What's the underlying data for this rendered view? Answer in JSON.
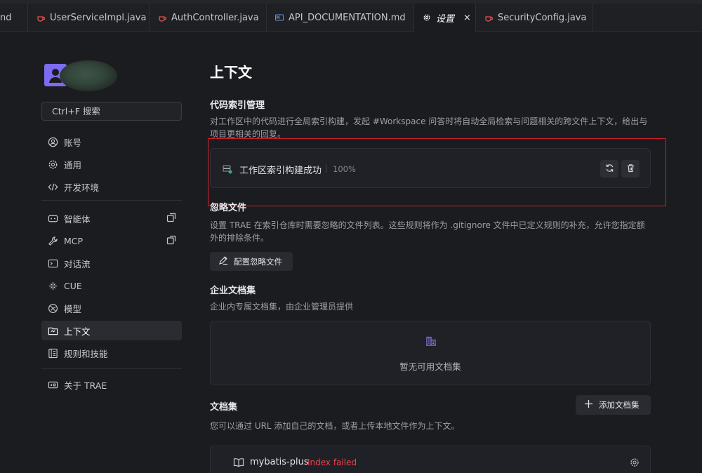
{
  "tabs": [
    {
      "label": "nd",
      "icon": "markdown-file-icon"
    },
    {
      "label": "UserServiceImpl.java",
      "icon": "java-file-icon"
    },
    {
      "label": "AuthController.java",
      "icon": "java-file-icon"
    },
    {
      "label": "API_DOCUMENTATION.md",
      "icon": "markdown-file-icon"
    },
    {
      "label": "设置",
      "icon": "gear-icon",
      "active": true,
      "close": "×"
    },
    {
      "label": "SecurityConfig.java",
      "icon": "java-file-icon"
    }
  ],
  "sidebar": {
    "search_placeholder": "Ctrl+F 搜索",
    "items": [
      {
        "label": "账号",
        "icon": "user-circle-icon"
      },
      {
        "label": "通用",
        "icon": "gear-icon"
      },
      {
        "label": "开发环境",
        "icon": "code-icon"
      },
      {
        "label": "智能体",
        "icon": "agent-icon"
      },
      {
        "label": "MCP",
        "icon": "wrench-icon"
      },
      {
        "label": "对话流",
        "icon": "terminal-icon"
      },
      {
        "label": "CUE",
        "icon": "cue-icon"
      },
      {
        "label": "模型",
        "icon": "model-icon"
      },
      {
        "label": "上下文",
        "icon": "context-icon",
        "active": true
      },
      {
        "label": "规则和技能",
        "icon": "rules-icon"
      },
      {
        "label": "关于 TRAE",
        "icon": "info-icon"
      }
    ]
  },
  "main": {
    "title": "上下文",
    "code_index": {
      "title": "代码索引管理",
      "desc": "对工作区中的代码进行全局索引构建，发起 #Workspace 问答时将自动全局检索与问题相关的跨文件上下文，给出与项目更相关的回复。",
      "status": "工作区索引构建成功",
      "progress": "100%",
      "progress_value": 100
    },
    "ignore": {
      "title": "忽略文件",
      "desc": "设置 TRAE 在索引仓库时需要忽略的文件列表。这些规则将作为 .gitignore 文件中已定义规则的补充，允许您指定额外的排除条件。",
      "button": "配置忽略文件"
    },
    "enterprise": {
      "title": "企业文档集",
      "desc": "企业内专属文档集，由企业管理员提供",
      "empty": "暂无可用文档集"
    },
    "docs": {
      "title": "文档集",
      "desc": "您可以通过 URL 添加自己的文档，或者上传本地文件作为上下文。",
      "add_button": "添加文档集",
      "items": [
        {
          "name": "mybatis-plus",
          "status": "Index failed"
        }
      ]
    }
  },
  "colors": {
    "accent": "#7c6cf2",
    "success": "#2fb37a",
    "error": "#f0404a",
    "highlight_outline": "#d0212b"
  }
}
